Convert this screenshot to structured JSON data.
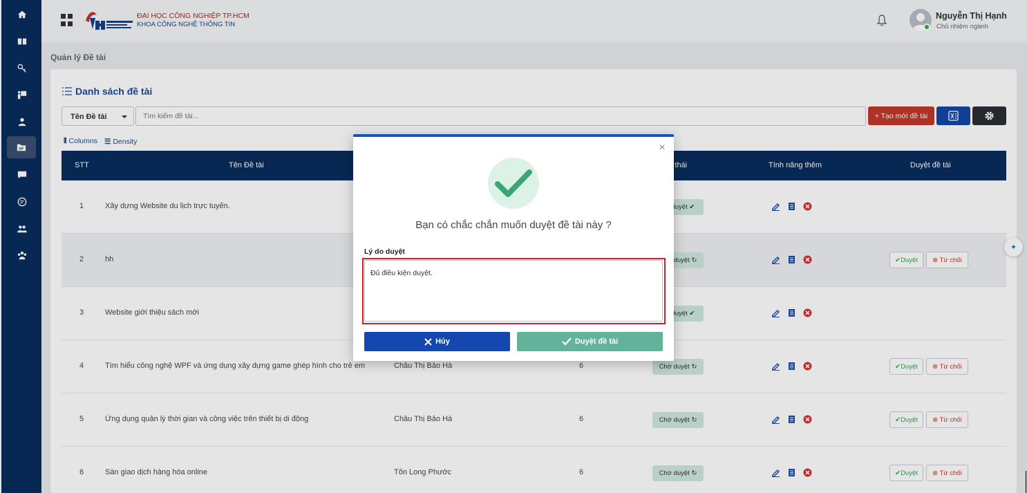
{
  "header": {
    "org_name": "ĐẠI HỌC CÔNG NGHIỆP TP.HCM",
    "org_sub": "KHOA CÔNG NGHỆ THÔNG TIN",
    "user_name": "Nguyễn Thị Hạnh",
    "user_role": "Chủ nhiệm ngành"
  },
  "sidebar": {
    "items": [
      "home-icon",
      "book-icon",
      "key-icon",
      "presentation-icon",
      "user-icon",
      "folder-icon",
      "chat-icon",
      "message-icon",
      "group-icon",
      "team-icon"
    ],
    "active": "folder-icon"
  },
  "page": {
    "breadcrumb": "Quản lý Đề tài",
    "list_title": "Danh sách đề tài",
    "filter_value": "Tên Đề tài",
    "search_placeholder": "Tìm kiếm đề tài...",
    "new_button": "+ Tạo mới đề tài",
    "columns_label": "Columns",
    "density_label": "Density"
  },
  "table": {
    "headers": {
      "stt": "STT",
      "name": "Tên Đề tài",
      "status": "Trạng thái",
      "features": "Tính năng thêm",
      "approve": "Duyệt đề tài"
    },
    "rows": [
      {
        "stt": "1",
        "name": "Xây dựng Website du lịch trực tuyến.",
        "teacher": "",
        "count": "",
        "status": "Đã duyệt ✔",
        "show_actions": false
      },
      {
        "stt": "2",
        "name": "hh",
        "teacher": "",
        "count": "",
        "status": "Chờ duyệt ↻",
        "show_actions": true
      },
      {
        "stt": "3",
        "name": "Website giới thiệu sách mới",
        "teacher": "",
        "count": "",
        "status": "Đã duyệt ✔",
        "show_actions": false
      },
      {
        "stt": "4",
        "name": "Tìm hiểu công nghệ WPF và ứng dụng xây dựng game ghép hình cho trẻ em",
        "teacher": "Châu Thị Bảo Hà",
        "count": "6",
        "status": "Chờ duyệt ↻",
        "show_actions": true
      },
      {
        "stt": "5",
        "name": "Ứng dụng quản lý thời gian và công việc trên thiết bị di động",
        "teacher": "Châu Thị Bảo Hà",
        "count": "6",
        "status": "Chờ duyệt ↻",
        "show_actions": true
      },
      {
        "stt": "6",
        "name": "Sàn giao dịch hàng hóa online",
        "teacher": "Tôn Long Phước",
        "count": "6",
        "status": "Chờ duyệt ↻",
        "show_actions": true
      }
    ],
    "approve_label": "✔Duyệt",
    "reject_label": "⊗ Từ chối"
  },
  "modal": {
    "message": "Bạn có chắc chắn muốn duyệt đề tài này ?",
    "reason_label": "Lý do duyệt",
    "reason_value": "Đủ điều kiện duyệt.",
    "cancel_label": "Hủy",
    "confirm_label": "Duyệt đề tài",
    "close_symbol": "×"
  },
  "colors": {
    "sidebar": "#0a2d5e",
    "primary": "#1654b8",
    "danger": "#c0392b",
    "success": "#62b39a"
  }
}
